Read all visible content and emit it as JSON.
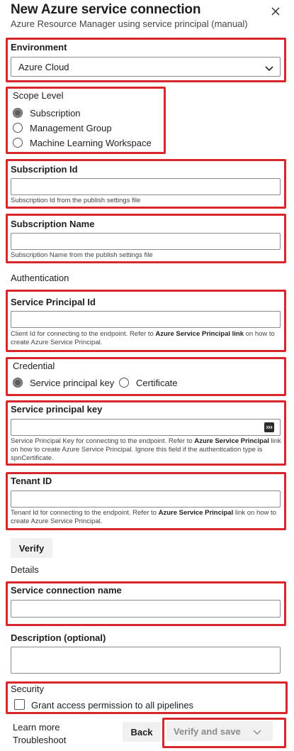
{
  "header": {
    "title": "New Azure service connection",
    "subtitle": "Azure Resource Manager using service principal (manual)"
  },
  "environment": {
    "label": "Environment",
    "value": "Azure Cloud"
  },
  "scope": {
    "label": "Scope Level",
    "options": [
      "Subscription",
      "Management Group",
      "Machine Learning Workspace"
    ],
    "selected": "Subscription"
  },
  "subscription_id": {
    "label": "Subscription Id",
    "value": "",
    "help": "Subscription Id from the publish settings file"
  },
  "subscription_name": {
    "label": "Subscription Name",
    "value": "",
    "help": "Subscription Name from the publish settings file"
  },
  "authentication_heading": "Authentication",
  "service_principal_id": {
    "label": "Service Principal Id",
    "value": "",
    "help_pre": "Client Id for connecting to the endpoint. Refer to ",
    "help_link": "Azure Service Principal link",
    "help_post": " on how to create Azure Service Principal."
  },
  "credential": {
    "label": "Credential",
    "options": [
      "Service principal key",
      "Certificate"
    ],
    "selected": "Service principal key"
  },
  "service_principal_key": {
    "label": "Service principal key",
    "value": "",
    "help_pre": "Service Principal Key for connecting to the endpoint. Refer to ",
    "help_link": "Azure Service Principal",
    "help_post": " link on how to create Azure Service Principal. Ignore this field if the authentication type is spnCertificate."
  },
  "tenant_id": {
    "label": "Tenant ID",
    "value": "",
    "help_pre": "Tenant Id for connecting to the endpoint. Refer to ",
    "help_link": "Azure Service Principal",
    "help_post": " link on how to create Azure Service Principal."
  },
  "verify_button": "Verify",
  "details_heading": "Details",
  "connection_name": {
    "label": "Service connection name",
    "value": ""
  },
  "description": {
    "label": "Description (optional)",
    "value": ""
  },
  "security": {
    "label": "Security",
    "checkbox_label": "Grant access permission to all pipelines",
    "checked": false
  },
  "footer": {
    "learn_more": "Learn more",
    "troubleshoot": "Troubleshoot",
    "back": "Back",
    "verify_and_save": "Verify and save"
  },
  "colors": {
    "highlight_border": "#d9262b",
    "radio_selected": "#5c5c5c",
    "button_bg": "#f0f0f0"
  }
}
